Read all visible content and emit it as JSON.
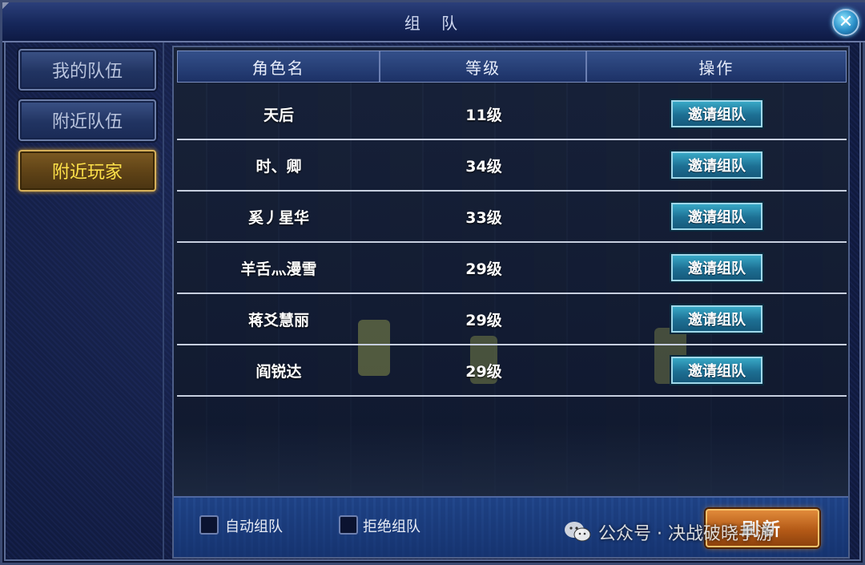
{
  "window": {
    "title": "组 队",
    "close_icon": "close-icon"
  },
  "sidebar": {
    "tabs": [
      {
        "label": "我的队伍",
        "active": false
      },
      {
        "label": "附近队伍",
        "active": false
      },
      {
        "label": "附近玩家",
        "active": true
      }
    ]
  },
  "table": {
    "headers": [
      "角色名",
      "等级",
      "操作"
    ],
    "rows": [
      {
        "name": "天后",
        "level": "11级",
        "action": "邀请组队"
      },
      {
        "name": "时、卿",
        "level": "34级",
        "action": "邀请组队"
      },
      {
        "name": "奚丿星华",
        "level": "33级",
        "action": "邀请组队"
      },
      {
        "name": "羊舌灬漫雪",
        "level": "29级",
        "action": "邀请组队"
      },
      {
        "name": "蒋爻慧丽",
        "level": "29级",
        "action": "邀请组队"
      },
      {
        "name": "阎锐达",
        "level": "29级",
        "action": "邀请组队"
      }
    ]
  },
  "footer": {
    "auto_team_label": "自动组队",
    "reject_team_label": "拒绝组队",
    "refresh_label": "刷新"
  },
  "watermark": {
    "text": "公众号 · 决战破晓手游"
  },
  "colors": {
    "accent": "#ffe24a",
    "button": "#1d6f93",
    "refresh": "#b45a17"
  }
}
